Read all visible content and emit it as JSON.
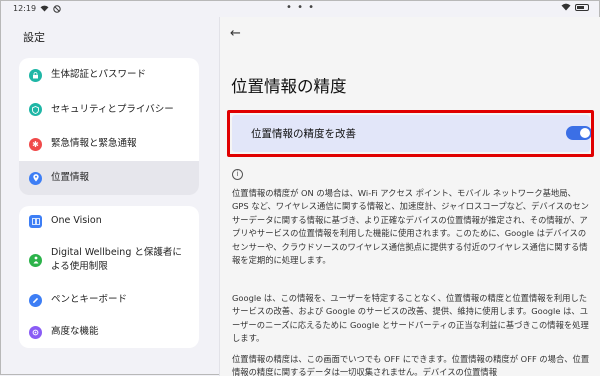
{
  "status": {
    "time": "12:19"
  },
  "sidebar": {
    "title": "設定",
    "groups": [
      [
        {
          "label": "生体認証とパスワード",
          "icon": "lock-icon",
          "color": "#1fb6a6"
        },
        {
          "label": "セキュリティとプライバシー",
          "icon": "shield-icon",
          "color": "#1fb6a6"
        },
        {
          "label": "緊急情報と緊急通報",
          "icon": "emergency-icon",
          "color": "#f04a4a"
        },
        {
          "label": "位置情報",
          "icon": "location-pin-icon",
          "color": "#3d7ef5",
          "active": true
        }
      ],
      [
        {
          "label": "One Vision",
          "icon": "one-vision-icon",
          "color": "#3d7ef5"
        },
        {
          "label": "Digital Wellbeing と保護者による使用制限",
          "icon": "wellbeing-icon",
          "color": "#2cb34a"
        },
        {
          "label": "ペンとキーボード",
          "icon": "pen-icon",
          "color": "#3d7ef5"
        },
        {
          "label": "高度な機能",
          "icon": "advanced-features-icon",
          "color": "#8a5cf5"
        }
      ]
    ]
  },
  "main": {
    "title": "位置情報の精度",
    "toggle": {
      "label": "位置情報の精度を改善",
      "state": "on"
    },
    "paragraphs": [
      "位置情報の精度が ON の場合は、Wi-Fi アクセス ポイント、モバイル ネットワーク基地局、GPS など、ワイヤレス通信に関する情報と、加速度計、ジャイロスコープなど、デバイスのセンサーデータに関する情報に基づき、より正確なデバイスの位置情報が推定され、その情報が、アプリやサービスの位置情報を利用した機能に使用されます。このために、Google はデバイスのセンサーや、クラウドソースのワイヤレス通信拠点に提供する付近のワイヤレス通信に関する情報を定期的に処理します。",
      "Google は、この情報を、ユーザーを特定することなく、位置情報の精度と位置情報を利用したサービスの改善、および Google のサービスの改善、提供、維持に使用します。Google は、ユーザーのニーズに応えるために Google とサードパーティの正当な利益に基づきこの情報を処理します。",
      "位置情報の精度は、この画面でいつでも OFF にできます。位置情報の精度が OFF の場合、位置情報の精度に関するデータは一切収集されません。デバイスの位置情報"
    ]
  }
}
